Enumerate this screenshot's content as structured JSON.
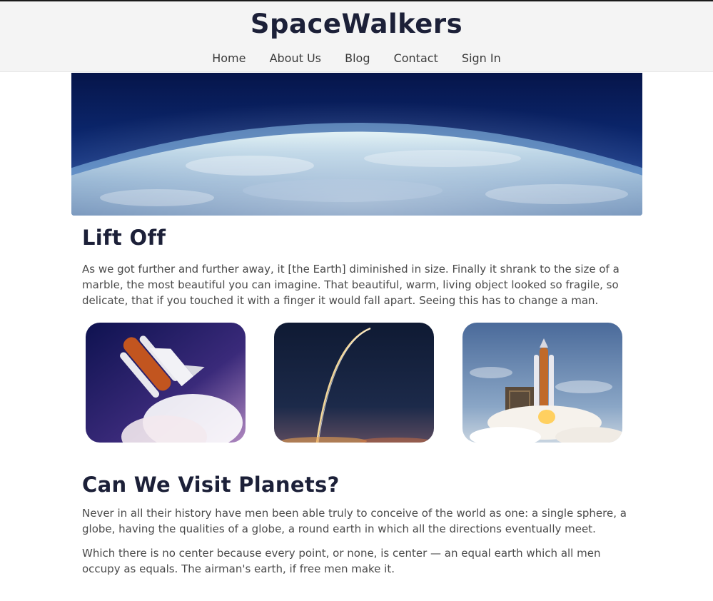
{
  "header": {
    "title": "SpaceWalkers",
    "nav": [
      "Home",
      "About Us",
      "Blog",
      "Contact",
      "Sign In"
    ]
  },
  "section1": {
    "heading": "Lift Off",
    "paragraph": "As we got further and further away, it [the Earth] diminished in size. Finally it shrank to the size of a marble, the most beautiful you can imagine. That beautiful, warm, living object looked so fragile, so delicate, that if you touched it with a finger it would fall apart. Seeing this has to change a man."
  },
  "section2": {
    "heading": "Can We Visit Planets?",
    "paragraph1": "Never in all their history have men been able truly to conceive of the world as one: a single sphere, a globe, having the qualities of a globe, a round earth in which all the directions eventually meet.",
    "paragraph2": "Which there is no center because every point, or none, is center — an equal earth which all men occupy as equals. The airman's earth, if free men make it."
  },
  "colors": {
    "heading": "#1c2038",
    "header_bg": "#f4f4f4",
    "text": "#4a4a4a"
  }
}
